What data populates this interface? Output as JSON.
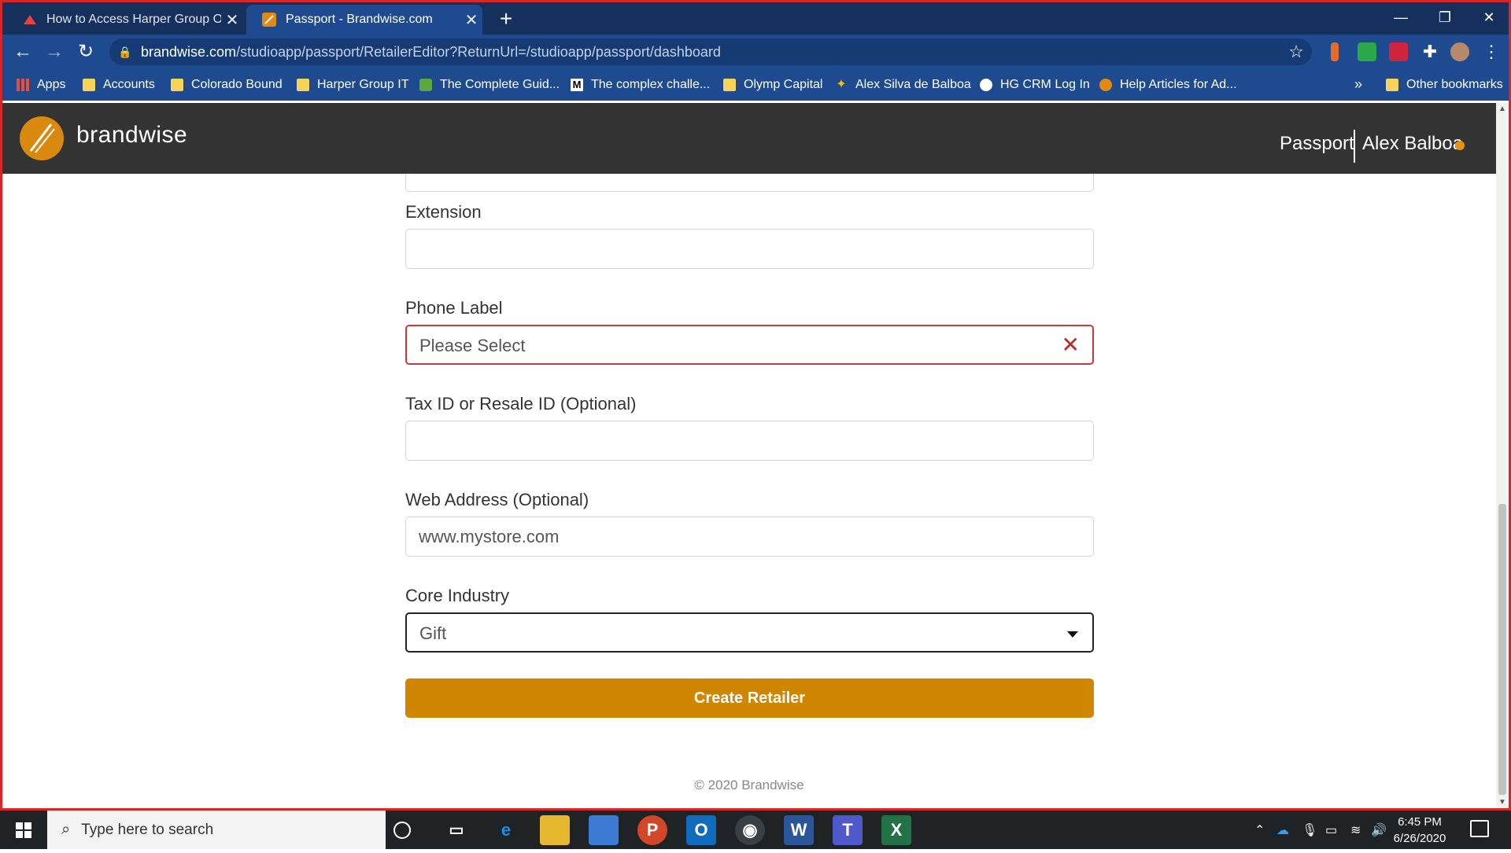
{
  "browser": {
    "tabs": [
      {
        "title": "How to Access Harper Group Onl",
        "active": false
      },
      {
        "title": "Passport - Brandwise.com",
        "active": true
      }
    ],
    "new_tab": "+",
    "url_domain": "brandwise.com",
    "url_path": "/studioapp/passport/RetailerEditor?ReturnUrl=/studioapp/passport/dashboard",
    "bookmarks": [
      {
        "label": "Apps",
        "icon": "apps-grid-icon"
      },
      {
        "label": "Accounts",
        "icon": "folder-icon"
      },
      {
        "label": "Colorado Bound",
        "icon": "folder-icon"
      },
      {
        "label": "Harper Group IT",
        "icon": "folder-icon"
      },
      {
        "label": "The Complete Guid...",
        "icon": "dollar-icon"
      },
      {
        "label": "The complex challe...",
        "icon": "medium-icon"
      },
      {
        "label": "Olymp Capital",
        "icon": "folder-icon"
      },
      {
        "label": "Alex Silva de Balboa",
        "icon": "pinwheel-icon"
      },
      {
        "label": "HG CRM Log In",
        "icon": "globe-icon"
      },
      {
        "label": "Help Articles for Ad...",
        "icon": "brandwise-icon"
      }
    ],
    "more_bookmarks": "»",
    "other_bookmarks": "Other bookmarks"
  },
  "app": {
    "brand": "brandwise",
    "nav_passport": "Passport",
    "user_name": "Alex Balboa",
    "accent_color": "#d18600"
  },
  "form": {
    "extension_label": "Extension",
    "extension_value": "",
    "phone_label_label": "Phone Label",
    "phone_label_value": "Please Select",
    "tax_label": "Tax ID or Resale ID (Optional)",
    "tax_value": "",
    "web_label": "Web Address (Optional)",
    "web_placeholder": "www.mystore.com",
    "industry_label": "Core Industry",
    "industry_value": "Gift",
    "submit_label": "Create Retailer"
  },
  "footer": "© 2020 Brandwise",
  "taskbar": {
    "search_placeholder": "Type here to search",
    "time": "6:45 PM",
    "date": "6/26/2020"
  }
}
